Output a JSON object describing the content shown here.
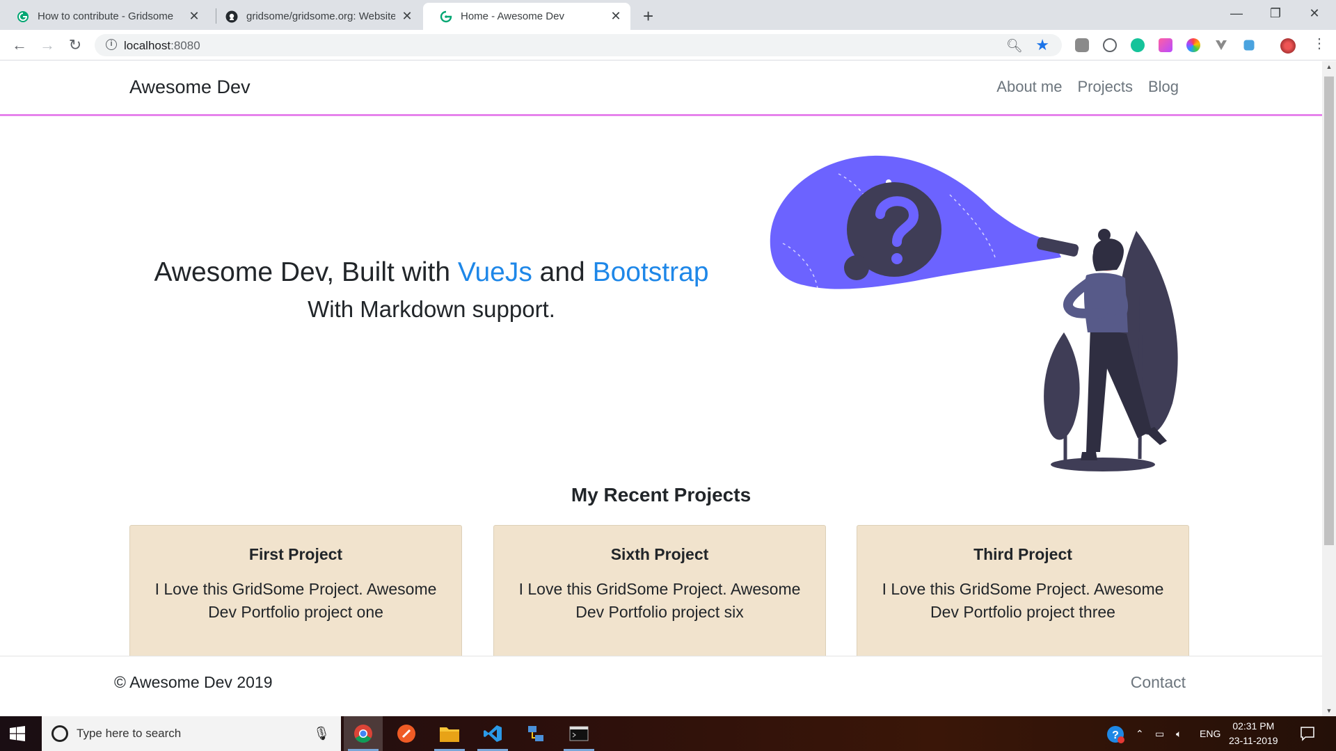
{
  "browser": {
    "tabs": [
      {
        "title": "How to contribute - Gridsome",
        "active": false
      },
      {
        "title": "gridsome/gridsome.org: Website",
        "active": false
      },
      {
        "title": "Home - Awesome Dev",
        "active": true
      }
    ],
    "url_host": "localhost",
    "url_port": ":8080"
  },
  "site": {
    "brand": "Awesome Dev",
    "nav": [
      "About me",
      "Projects",
      "Blog"
    ],
    "hero": {
      "line1_prefix": "Awesome Dev, Built with ",
      "line1_link1": "VueJs",
      "line1_mid": " and ",
      "line1_link2": "Bootstrap",
      "line2": "With Markdown support."
    },
    "section_title": "My Recent Projects",
    "projects": [
      {
        "title": "First Project",
        "desc": "I Love this GridSome Project. Awesome Dev Portfolio project one"
      },
      {
        "title": "Sixth Project",
        "desc": "I Love this GridSome Project. Awesome Dev Portfolio project six"
      },
      {
        "title": "Third Project",
        "desc": "I Love this GridSome Project. Awesome Dev Portfolio project three"
      }
    ],
    "footer": {
      "copyright": "© Awesome Dev 2019",
      "contact": "Contact"
    }
  },
  "taskbar": {
    "search_placeholder": "Type here to search",
    "language": "ENG",
    "time": "02:31 PM",
    "date": "23-11-2019"
  },
  "colors": {
    "accent_link": "#1e87e8",
    "nav_border": "#e683ec",
    "card_bg": "#f1e3cd",
    "illustration": "#6c63ff"
  }
}
